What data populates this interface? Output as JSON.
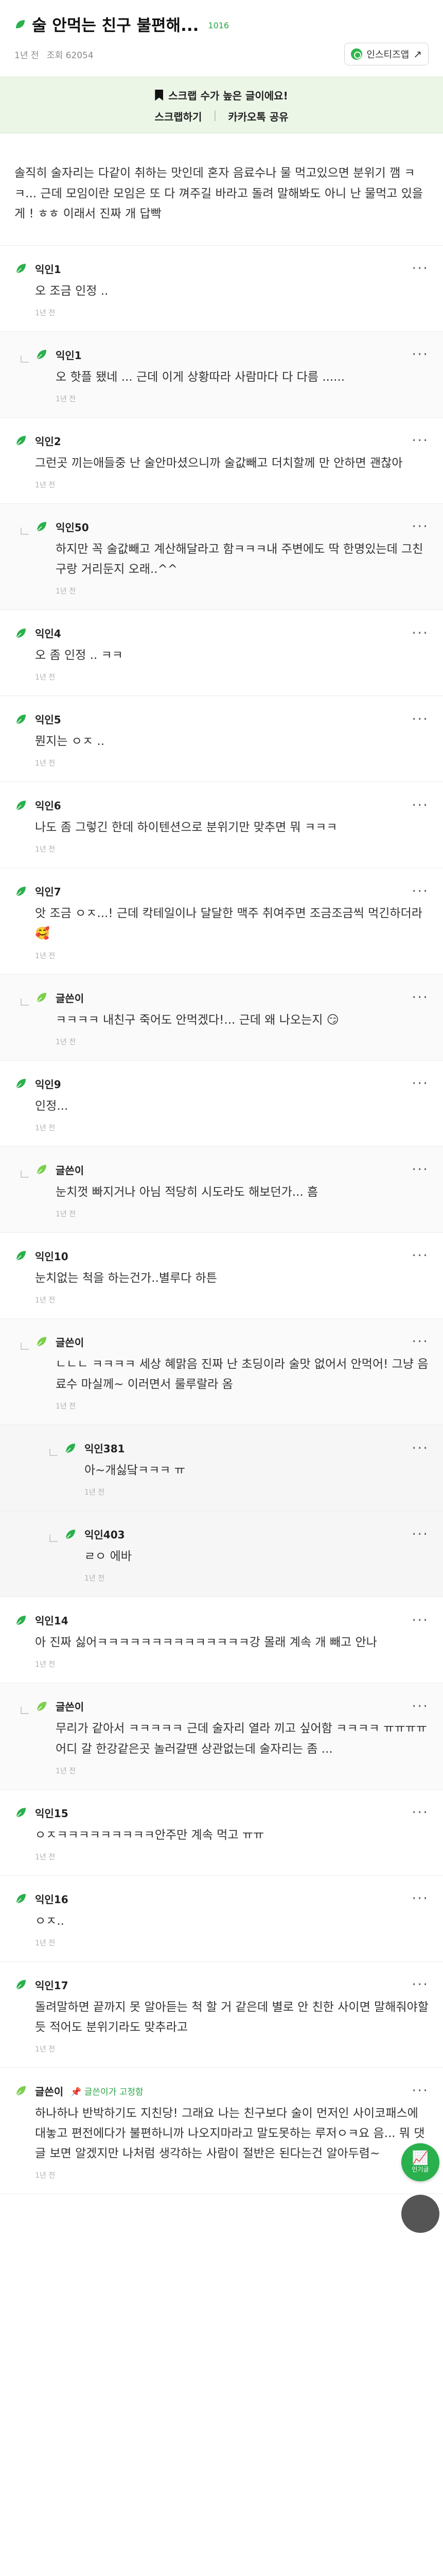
{
  "header": {
    "title": "술 안먹는 친구 불편해...",
    "title_count": "1016",
    "time": "1년 전",
    "views": "조회 62054",
    "instagram_label": "인스티즈앱"
  },
  "scrap": {
    "message": "스크랩 수가 높은 글이에요!",
    "scrap_label": "스크랩하기",
    "kakao_label": "카카오톡 공유"
  },
  "post": {
    "body": "솔직히 술자리는 다같이 취하는 맛인데 혼자 음료수나 물 먹고있으면 분위기 깸 ㅋㅋ... 근데 모임이란 모임은 또 다 껴주길 바라고 돌려 말해봐도 아니 난 물먹고 있을게 ! ㅎㅎ 이래서 진짜 개 답빡"
  },
  "comments": [
    {
      "nick": "익인1",
      "text": "오 조금 인정 ..",
      "time": "1년 전",
      "level": 0
    },
    {
      "nick": "익인1",
      "text": "오 핫플 됐네 ... 근데 이게 상황따라 사람마다 다 다름 ......",
      "time": "1년 전",
      "level": 1
    },
    {
      "nick": "익인2",
      "text": "그런곳 끼는애들중 난 술안마셨으니까 술값빼고 더치할께 만 안하면 괜찮아",
      "time": "1년 전",
      "level": 0
    },
    {
      "nick": "익인50",
      "text": "하지만 꼭 술값빼고 계산해달라고 함ㅋㅋㅋ내 주변에도 딱 한명있는데 그친구랑 거리둔지 오래..^^",
      "time": "1년 전",
      "level": 1
    },
    {
      "nick": "익인4",
      "text": "오 좀 인정 .. ㅋㅋ",
      "time": "1년 전",
      "level": 0
    },
    {
      "nick": "익인5",
      "text": "뭔지는 ㅇㅈ ..",
      "time": "1년 전",
      "level": 0
    },
    {
      "nick": "익인6",
      "text": "나도 좀 그렇긴 한데 하이텐션으로 분위기만 맞추면 뭐 ㅋㅋㅋ",
      "time": "1년 전",
      "level": 0
    },
    {
      "nick": "익인7",
      "text": "앗 조금 ㅇㅈ...! 근데 칵테일이나 달달한 맥주 취여주면 조금조금씩 먹긴하더라🥰",
      "time": "1년 전",
      "level": 0
    },
    {
      "nick": "글쓴이",
      "text": "ㅋㅋㅋㅋ 내친구 죽어도 안먹겠다!... 근데 왜 나오는지 😏",
      "time": "1년 전",
      "level": 1,
      "author": true
    },
    {
      "nick": "익인9",
      "text": "인정...",
      "time": "1년 전",
      "level": 0
    },
    {
      "nick": "글쓴이",
      "text": "눈치껏 빠지거나 아님 적당히 시도라도 해보던가... 흠",
      "time": "1년 전",
      "level": 1,
      "author": true
    },
    {
      "nick": "익인10",
      "text": "눈치없는 척을 하는건가..별루다 하튼",
      "time": "1년 전",
      "level": 0
    },
    {
      "nick": "글쓴이",
      "text": "ㄴㄴㄴ ㅋㅋㅋㅋ 세상 혜맑음 진짜 난 초딩이라 술맛 없어서 안먹어! 그냥 음료수 마실께~ 이러면서 룰루랄라 옴",
      "time": "1년 전",
      "level": 1,
      "author": true
    },
    {
      "nick": "익인381",
      "text": "아~개싫닼ㅋㅋㅋ ㅠ",
      "time": "1년 전",
      "level": 2
    },
    {
      "nick": "익인403",
      "text": "ㄹㅇ 에바",
      "time": "1년 전",
      "level": 2
    },
    {
      "nick": "익인14",
      "text": "아 진짜 싫어ㅋㅋㅋㅋㅋㅋㅋㅋㅋㅋㅋㅋㅋㅋ강 몰래 계속 개 빼고 안나",
      "time": "1년 전",
      "level": 0
    },
    {
      "nick": "글쓴이",
      "text": "무리가 같아서 ㅋㅋㅋㅋㅋ 근데 술자리 열라 끼고 싶어함 ㅋㅋㅋㅋ ㅠㅠㅠㅠ 어디 갈 한강같은곳 놀러갈땐 상관없는데 술자리는 좀 ...",
      "time": "1년 전",
      "level": 1,
      "author": true
    },
    {
      "nick": "익인15",
      "text": "ㅇㅈㅋㅋㅋㅋㅋㅋㅋㅋㅋ안주만 계속 먹고 ㅠㅠ",
      "time": "1년 전",
      "level": 0
    },
    {
      "nick": "익인16",
      "text": "ㅇㅈ..",
      "time": "1년 전",
      "level": 0
    },
    {
      "nick": "익인17",
      "text": "돌려말하면 끝까지 못 알아듣는 척 할 거 같은데 별로 안 친한 사이면 말해줘야할듯 적어도 분위기라도 맞추라고",
      "time": "1년 전",
      "level": 0
    },
    {
      "nick": "글쓴이",
      "badge": "글쓴이가 고정함",
      "text": "하나하나 반박하기도 지친당! 그래요 나는 친구보다 술이 먼저인 사이코패스에 대놓고 편전에다가 불편하니까 나오지마라고 말도못하는 루저ㅇㅋ요 음... 뭐 댓글 보면 알겠지만 나처럼 생각하는 사람이 절반은 된다는건 알아두렴~",
      "time": "1년 전",
      "level": 0,
      "author": true
    }
  ],
  "fab": {
    "label": "인기글"
  },
  "colors": {
    "accent": "#2ab04c",
    "scrap_bg": "#ecf6e7"
  }
}
